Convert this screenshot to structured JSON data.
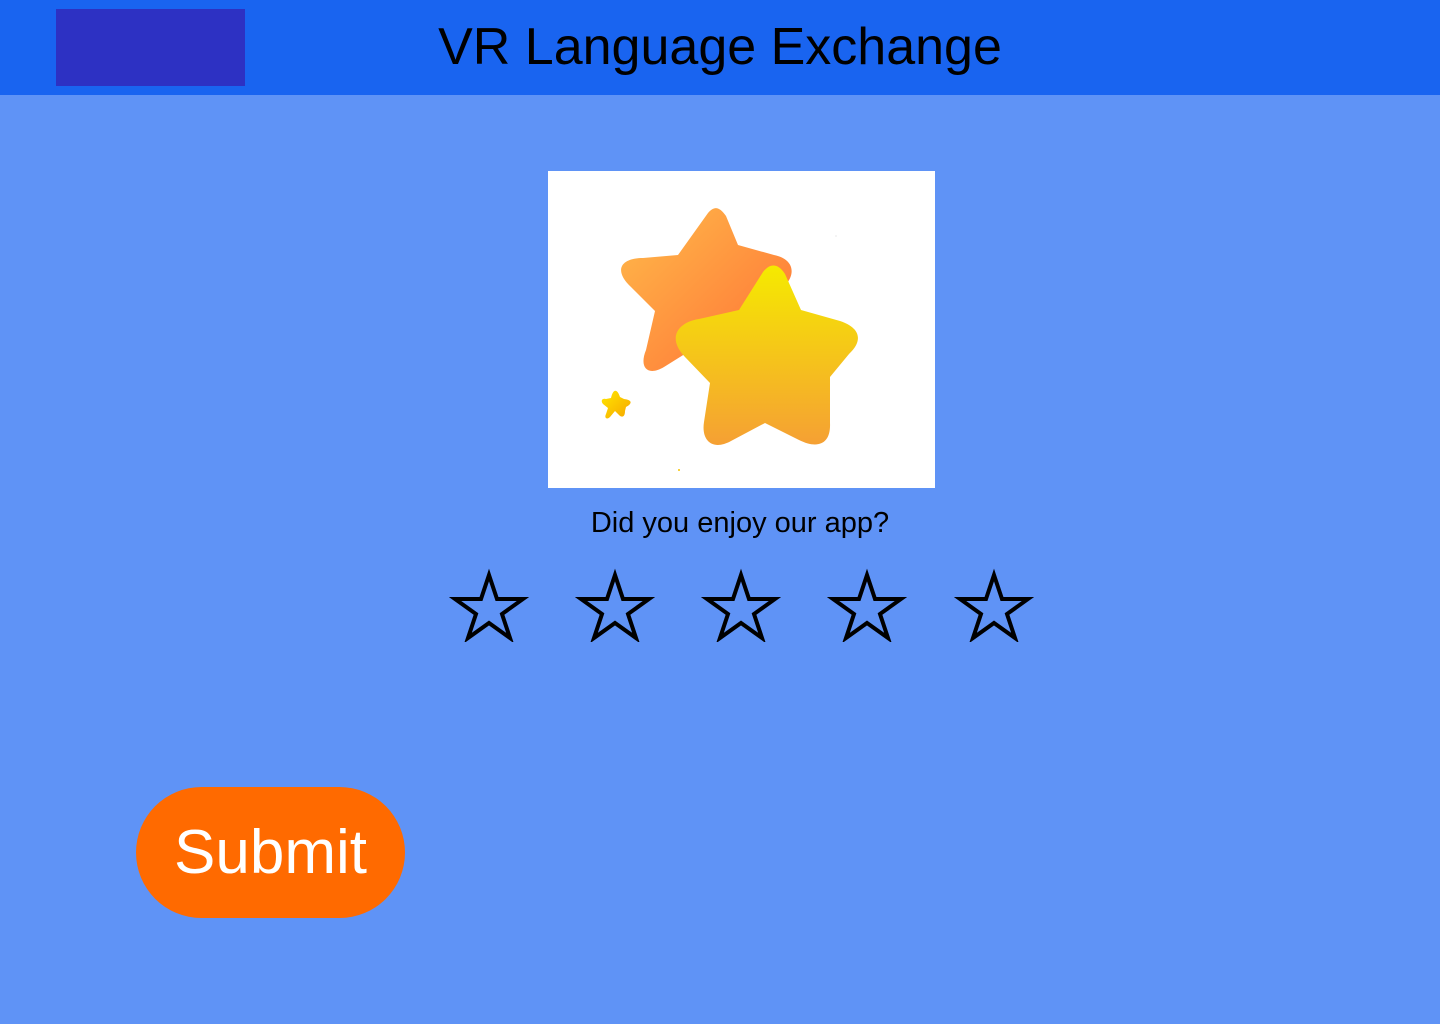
{
  "app": {
    "title": "VR Language Exchange"
  },
  "hero": {
    "image": "stars-illustration"
  },
  "feedback": {
    "question": "Did you enjoy our app?",
    "rating": {
      "value": 0,
      "max": 5,
      "icon": "star-outline-icon"
    }
  },
  "actions": {
    "submit_label": "Submit"
  },
  "colors": {
    "background": "#5f93f6",
    "header": "#1964f0",
    "logo": "#2d31c3",
    "submit": "#ff6a00",
    "submit_text": "#ffffff",
    "star_outline": "#000000"
  }
}
